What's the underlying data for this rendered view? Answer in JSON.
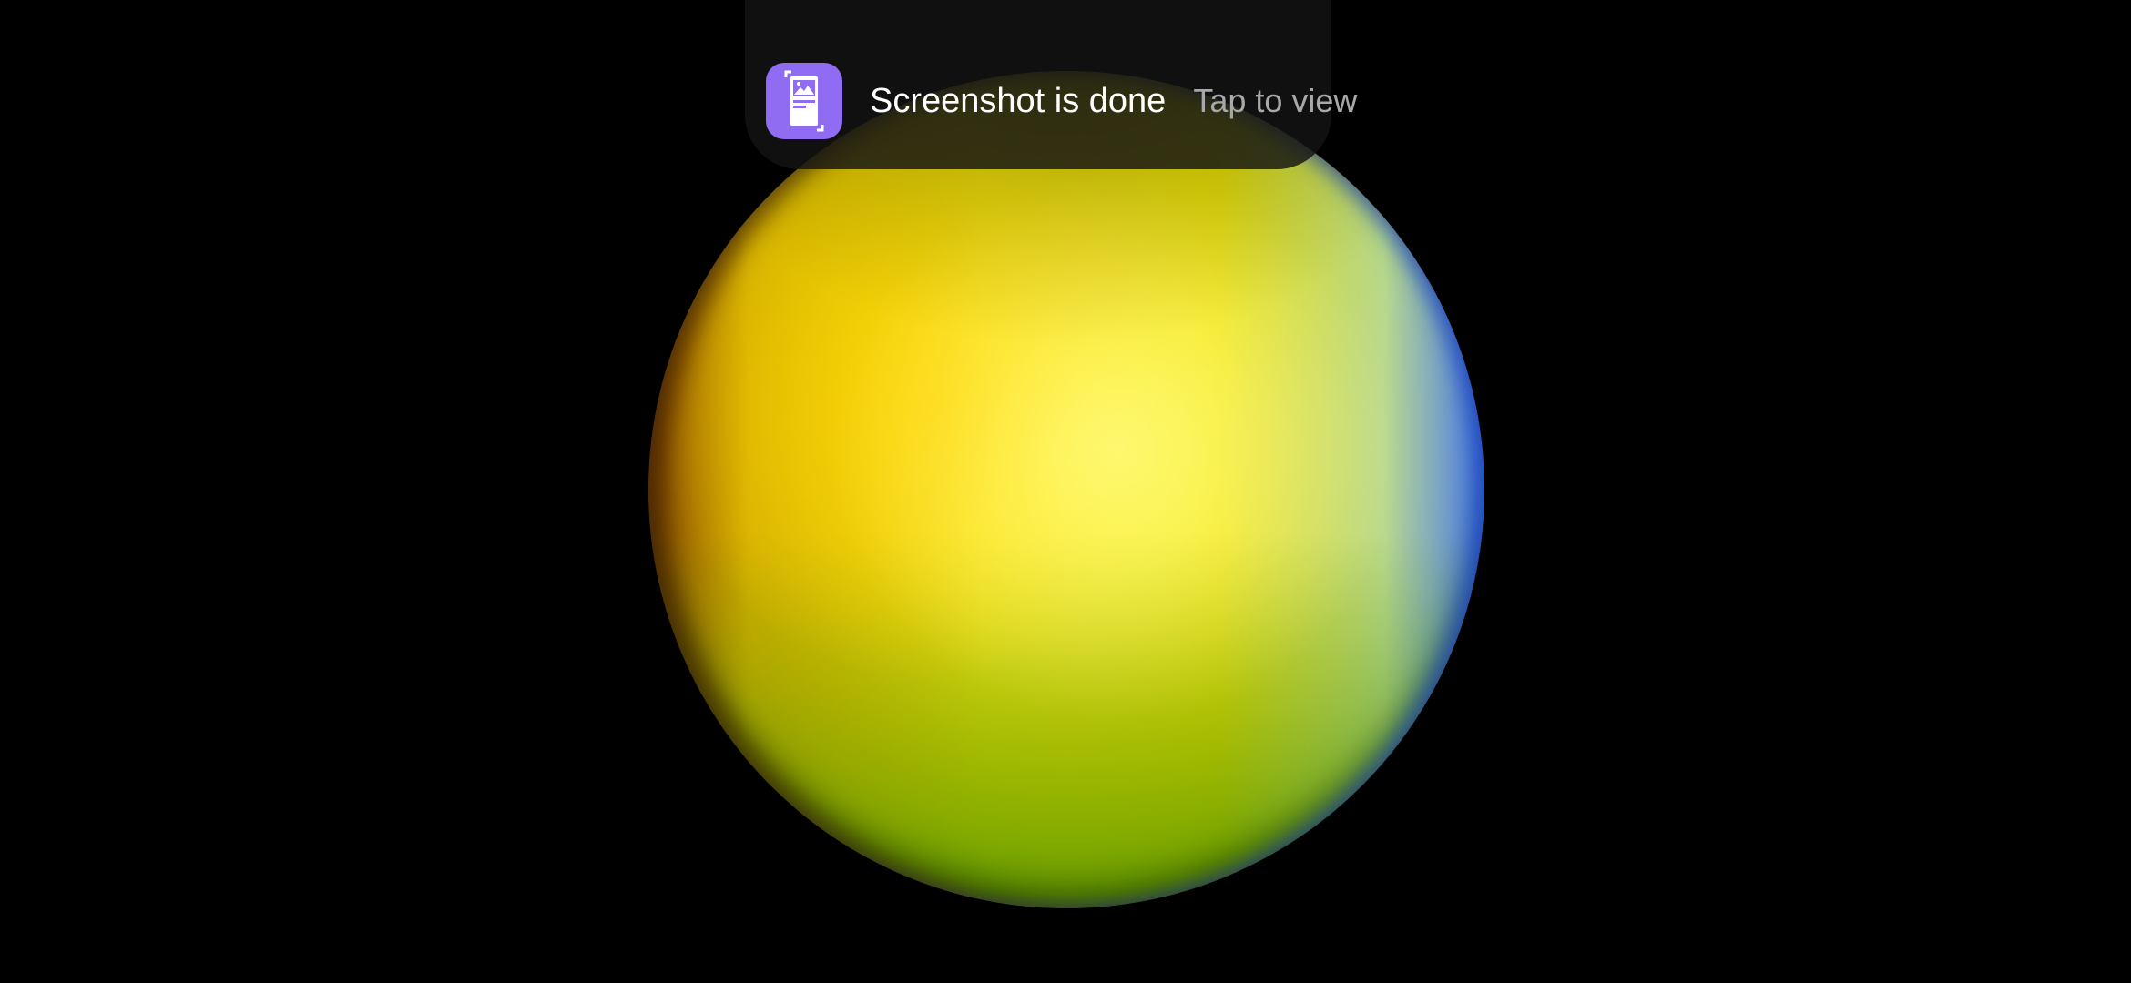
{
  "notification": {
    "title": "Screenshot is done",
    "action": "Tap to view",
    "app_icon": "screenshot-app-icon",
    "icon_color": "#8f6cf1"
  },
  "scene": {
    "background_color": "#000000",
    "object": "shaded-sphere",
    "colors": [
      "#ffff40",
      "#e6d800",
      "#5d8a00",
      "#4670ff",
      "#8c4600"
    ]
  }
}
